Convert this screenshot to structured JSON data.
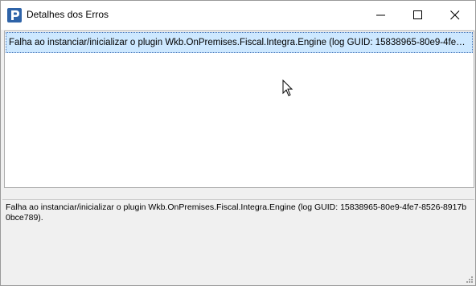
{
  "window": {
    "title": "Detalhes dos Erros",
    "icon": "p-app-icon"
  },
  "titlebar_buttons": {
    "minimize": "minimize-icon",
    "maximize": "maximize-icon",
    "close": "close-icon"
  },
  "error_list": {
    "rows": [
      {
        "text": "Falha ao instanciar/inicializar o plugin Wkb.OnPremises.Fiscal.Integra.Engine (log GUID: 15838965-80e9-4fe7-8526-8917b0bce789)."
      }
    ]
  },
  "detail": {
    "text": "Falha ao instanciar/inicializar o plugin Wkb.OnPremises.Fiscal.Integra.Engine (log GUID: 15838965-80e9-4fe7-8526-8917b0bce789)."
  },
  "colors": {
    "selection": "#cde8ff",
    "app_icon": "#2e63a8",
    "panel_bg": "#f0f0f0"
  }
}
